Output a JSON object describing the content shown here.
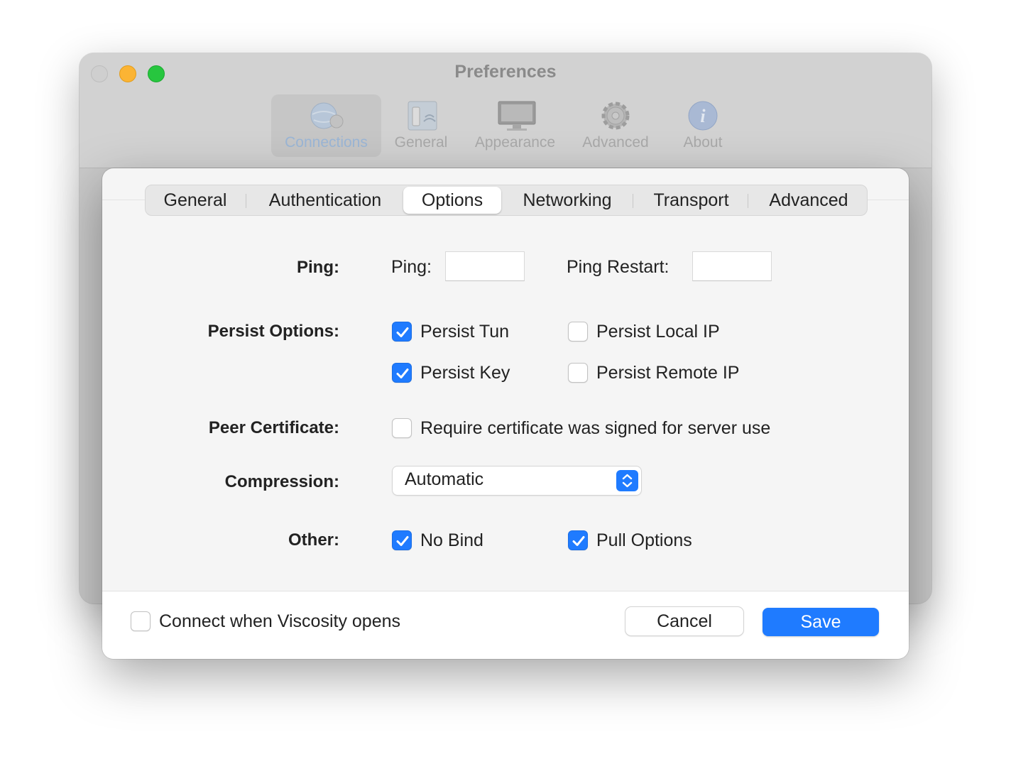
{
  "window": {
    "title": "Preferences",
    "toolbar": [
      {
        "label": "Connections",
        "icon": "connections-globe-icon",
        "selected": true
      },
      {
        "label": "General",
        "icon": "general-switch-icon",
        "selected": false
      },
      {
        "label": "Appearance",
        "icon": "appearance-monitor-icon",
        "selected": false
      },
      {
        "label": "Advanced",
        "icon": "advanced-gear-icon",
        "selected": false
      },
      {
        "label": "About",
        "icon": "about-info-icon",
        "selected": false
      }
    ]
  },
  "sheet": {
    "tabs": [
      {
        "label": "General",
        "selected": false
      },
      {
        "label": "Authentication",
        "selected": false
      },
      {
        "label": "Options",
        "selected": true
      },
      {
        "label": "Networking",
        "selected": false
      },
      {
        "label": "Transport",
        "selected": false
      },
      {
        "label": "Advanced",
        "selected": false
      }
    ],
    "ping": {
      "label": "Ping:",
      "ping_label": "Ping:",
      "ping_value": "",
      "restart_label": "Ping Restart:",
      "restart_value": ""
    },
    "persist": {
      "label": "Persist Options:",
      "persist_tun": {
        "label": "Persist Tun",
        "checked": true
      },
      "persist_key": {
        "label": "Persist Key",
        "checked": true
      },
      "persist_local_ip": {
        "label": "Persist Local IP",
        "checked": false
      },
      "persist_remote_ip": {
        "label": "Persist Remote IP",
        "checked": false
      }
    },
    "peer_certificate": {
      "label": "Peer Certificate:",
      "require_server": {
        "label": "Require certificate was signed for server use",
        "checked": false
      }
    },
    "compression": {
      "label": "Compression:",
      "value": "Automatic"
    },
    "other": {
      "label": "Other:",
      "no_bind": {
        "label": "No Bind",
        "checked": true
      },
      "pull_options": {
        "label": "Pull Options",
        "checked": true
      }
    },
    "footer": {
      "connect_on_open": {
        "label": "Connect when Viscosity opens",
        "checked": false
      },
      "cancel_label": "Cancel",
      "save_label": "Save"
    }
  },
  "colors": {
    "accent": "#1f7bff",
    "traffic_min": "#fbb434",
    "traffic_max": "#27c63f"
  }
}
